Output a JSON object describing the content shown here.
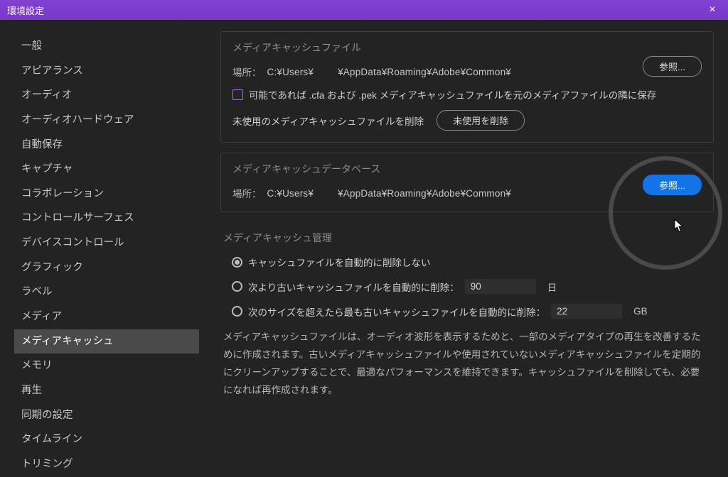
{
  "window": {
    "title": "環境設定",
    "close": "×"
  },
  "sidebar": {
    "items": [
      {
        "label": "一般"
      },
      {
        "label": "アピアランス"
      },
      {
        "label": "オーディオ"
      },
      {
        "label": "オーディオハードウェア"
      },
      {
        "label": "自動保存"
      },
      {
        "label": "キャプチャ"
      },
      {
        "label": "コラボレーション"
      },
      {
        "label": "コントロールサーフェス"
      },
      {
        "label": "デバイスコントロール"
      },
      {
        "label": "グラフィック"
      },
      {
        "label": "ラベル"
      },
      {
        "label": "メディア"
      },
      {
        "label": "メディアキャッシュ",
        "selected": true
      },
      {
        "label": "メモリ"
      },
      {
        "label": "再生"
      },
      {
        "label": "同期の設定"
      },
      {
        "label": "タイムライン"
      },
      {
        "label": "トリミング"
      }
    ]
  },
  "mediaCacheFiles": {
    "title": "メディアキャッシュファイル",
    "locationLabel": "場所：",
    "locationPath1": "C:¥Users¥",
    "locationPath2": "¥AppData¥Roaming¥Adobe¥Common¥",
    "browse": "参照...",
    "checkboxLabel": "可能であれば .cfa および .pek メディアキャッシュファイルを元のメディアファイルの隣に保存",
    "deleteLabel": "未使用のメディアキャッシュファイルを削除",
    "deleteButton": "未使用を削除"
  },
  "mediaCacheDb": {
    "title": "メディアキャッシュデータベース",
    "locationLabel": "場所：",
    "locationPath1": "C:¥Users¥",
    "locationPath2": "¥AppData¥Roaming¥Adobe¥Common¥",
    "browse": "参照..."
  },
  "mediaCacheMgmt": {
    "title": "メディアキャッシュ管理",
    "option1": "キャッシュファイルを自動的に削除しない",
    "option2": "次より古いキャッシュファイルを自動的に削除：",
    "option2Value": "90",
    "option2Unit": "日",
    "option3": "次のサイズを超えたら最も古いキャッシュファイルを自動的に削除：",
    "option3Value": "22",
    "option3Unit": "GB",
    "description": "メディアキャッシュファイルは、オーディオ波形を表示するためと、一部のメディアタイプの再生を改善するために作成されます。古いメディアキャッシュファイルや使用されていないメディアキャッシュファイルを定期的にクリーンアップすることで、最適なパフォーマンスを維持できます。キャッシュファイルを削除しても、必要になれば再作成されます。"
  }
}
